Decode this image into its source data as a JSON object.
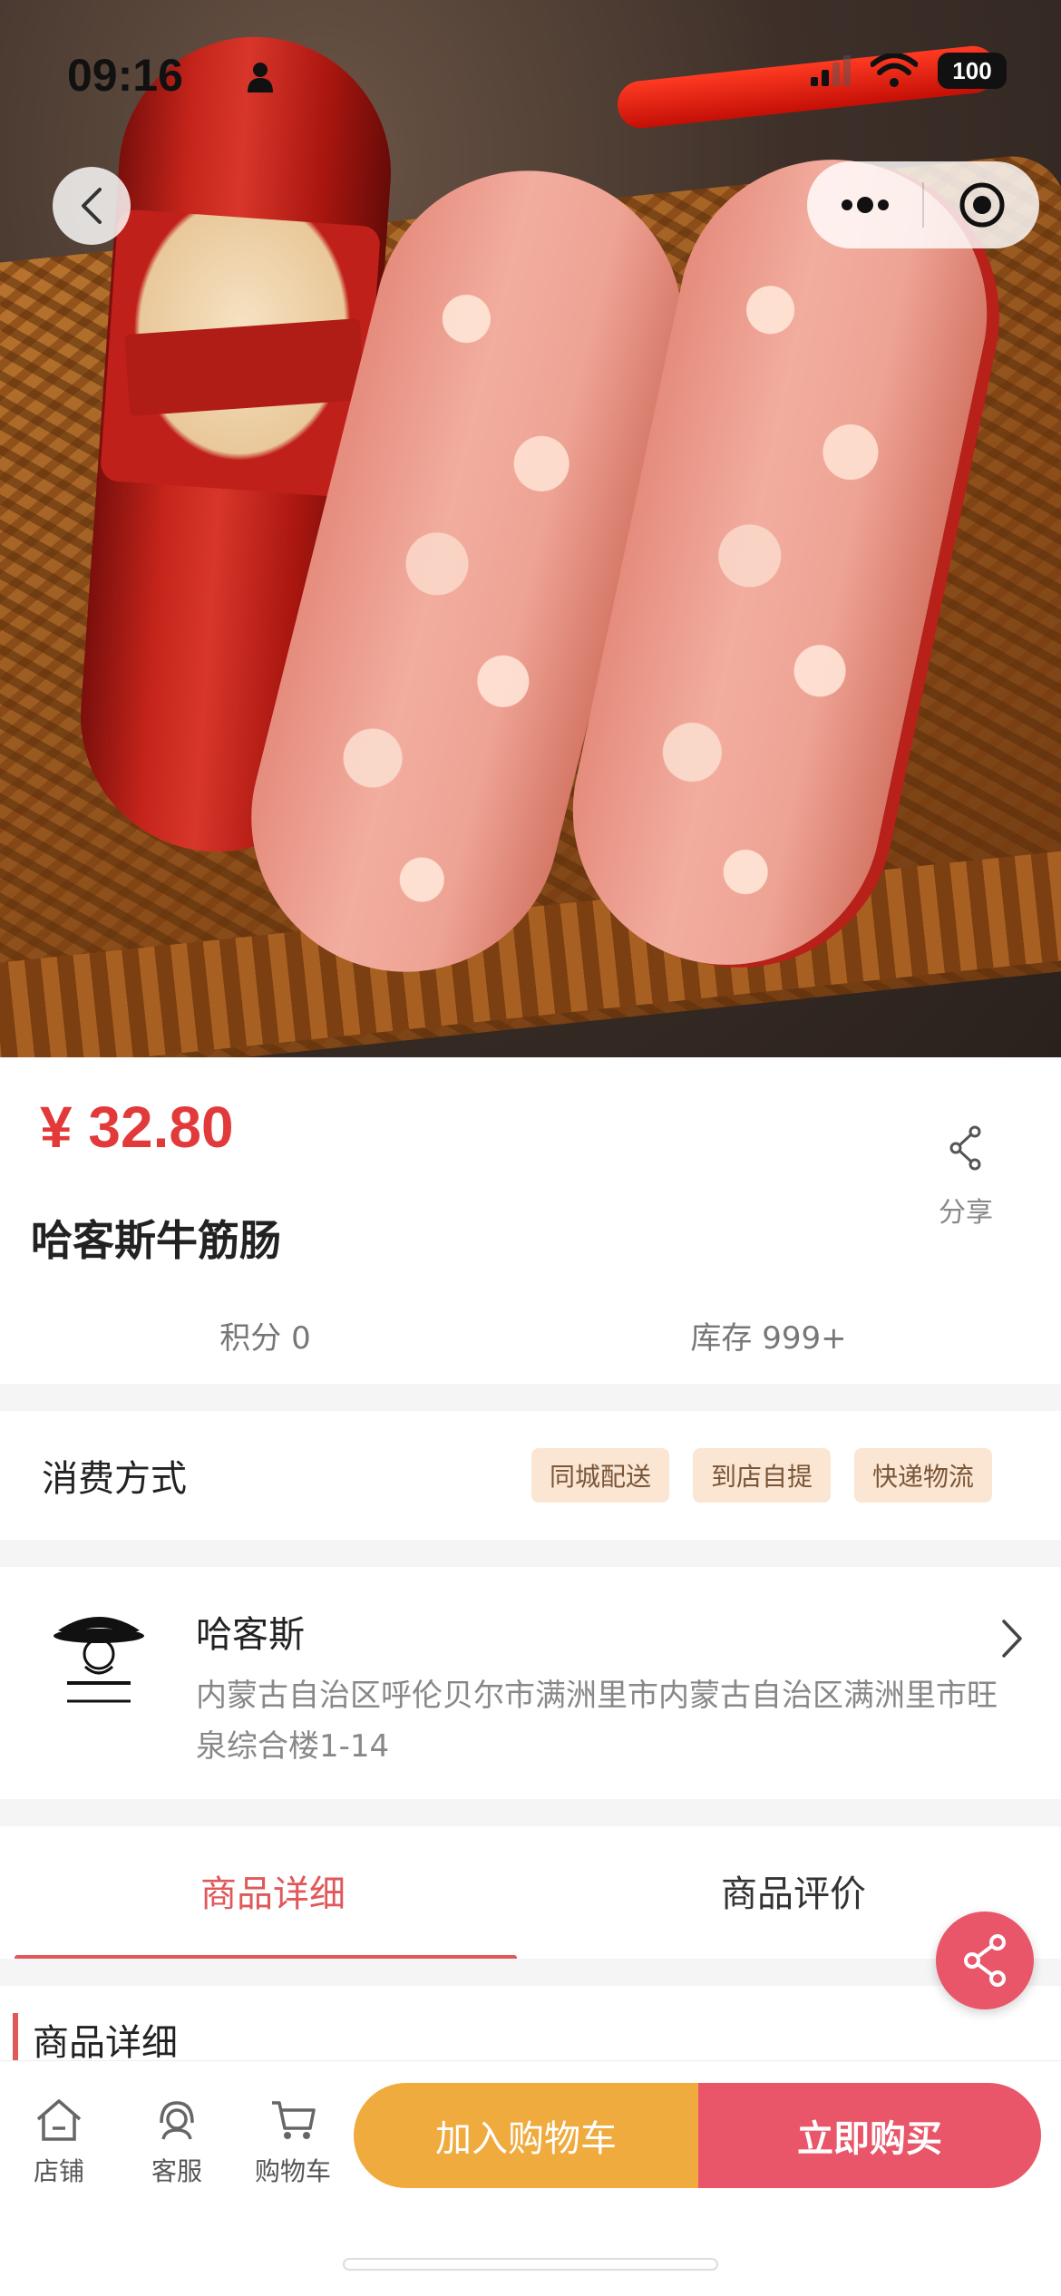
{
  "status_bar": {
    "time": "09:16",
    "battery": "100"
  },
  "product": {
    "price": "¥ 32.80",
    "title": "哈客斯牛筋肠"
  },
  "share": {
    "label": "分享"
  },
  "stats": {
    "points": "积分 0",
    "stock": "库存 999+"
  },
  "consume": {
    "label": "消费方式",
    "options": [
      "同城配送",
      "到店自提",
      "快递物流"
    ]
  },
  "store": {
    "name": "哈客斯",
    "address": "内蒙古自治区呼伦贝尔市满洲里市内蒙古自治区满洲里市旺泉综合楼1-14"
  },
  "tabs": [
    {
      "label": "商品详细",
      "active": true
    },
    {
      "label": "商品评价",
      "active": false
    }
  ],
  "section": {
    "title": "商品详细"
  },
  "bottom_nav": [
    {
      "label": "店铺",
      "icon": "home-icon"
    },
    {
      "label": "客服",
      "icon": "customer-service-icon"
    },
    {
      "label": "购物车",
      "icon": "cart-icon"
    }
  ],
  "actions": {
    "add_to_cart": "加入购物车",
    "buy_now": "立即购买"
  },
  "colors": {
    "price": "#e23a3a",
    "accent": "#e0585a",
    "cart_button": "#f0ab3e",
    "buy_button": "#e9566a",
    "tag_bg": "#fbe6d3"
  }
}
